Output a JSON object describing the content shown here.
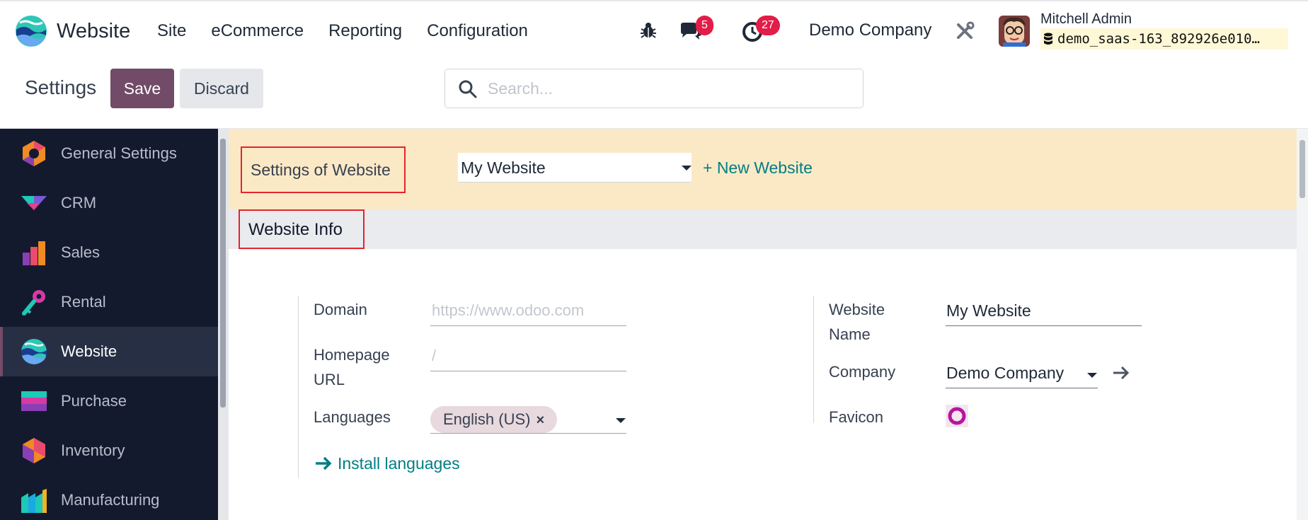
{
  "topbar": {
    "app_name": "Website",
    "menu": [
      "Site",
      "eCommerce",
      "Reporting",
      "Configuration"
    ],
    "messages_count": "5",
    "activities_count": "27",
    "company": "Demo Company",
    "user_name": "Mitchell Admin",
    "database": "demo_saas-163_892926e010…"
  },
  "control": {
    "title": "Settings",
    "save_label": "Save",
    "discard_label": "Discard",
    "search_placeholder": "Search..."
  },
  "sidebar": {
    "items": [
      {
        "label": "General Settings",
        "icon": "general-settings-icon"
      },
      {
        "label": "CRM",
        "icon": "crm-icon"
      },
      {
        "label": "Sales",
        "icon": "sales-icon"
      },
      {
        "label": "Rental",
        "icon": "rental-icon"
      },
      {
        "label": "Website",
        "icon": "website-icon",
        "active": true
      },
      {
        "label": "Purchase",
        "icon": "purchase-icon"
      },
      {
        "label": "Inventory",
        "icon": "inventory-icon"
      },
      {
        "label": "Manufacturing",
        "icon": "manufacturing-icon"
      }
    ]
  },
  "website_settings": {
    "label": "Settings of Website",
    "selected_website": "My Website",
    "new_website_label": "+ New Website"
  },
  "website_info": {
    "title": "Website Info",
    "domain_label": "Domain",
    "domain_placeholder": "https://www.odoo.com",
    "homepage_label": "Homepage URL",
    "homepage_placeholder": "/",
    "languages_label": "Languages",
    "language_tag": "English (US)",
    "tag_remove": "×",
    "install_languages": "Install languages",
    "website_name_label": "Website Name",
    "website_name_value": "My Website",
    "company_label": "Company",
    "company_value": "Demo Company",
    "favicon_label": "Favicon"
  },
  "colors": {
    "accent": "#714b67",
    "link": "#017e84",
    "sidebar_bg": "#141a2e",
    "highlight_band": "#fbe9c6",
    "annotation_box": "#e4242b",
    "badge": "#e11d48"
  }
}
